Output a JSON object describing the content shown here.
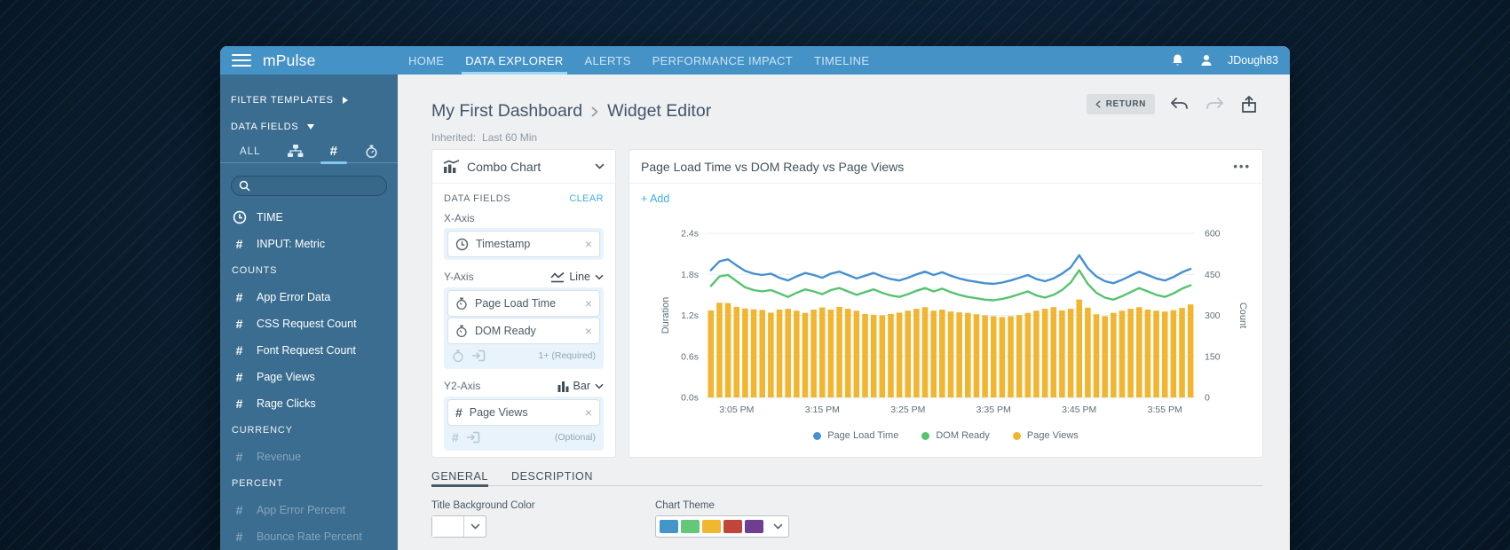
{
  "app": {
    "logo": "mPulse",
    "nav": [
      {
        "label": "HOME",
        "active": false
      },
      {
        "label": "DATA EXPLORER",
        "active": true
      },
      {
        "label": "ALERTS",
        "active": false
      },
      {
        "label": "PERFORMANCE IMPACT",
        "active": false
      },
      {
        "label": "TIMELINE",
        "active": false
      }
    ],
    "username": "JDough83",
    "accent_color": "#4592c7"
  },
  "sidebar": {
    "filter_templates_label": "FILTER TEMPLATES",
    "data_fields_label": "DATA FIELDS",
    "tabs": {
      "all_label": "ALL",
      "icons": [
        "hierarchy-icon",
        "hash-icon",
        "timer-icon"
      ],
      "active": "hash"
    },
    "search_value": "",
    "items": [
      {
        "type": "item",
        "icon": "clock",
        "label": "TIME"
      },
      {
        "type": "item",
        "icon": "hash",
        "label": "INPUT: Metric"
      },
      {
        "type": "section",
        "label": "COUNTS"
      },
      {
        "type": "item",
        "icon": "hash",
        "label": "App Error Data"
      },
      {
        "type": "item",
        "icon": "hash",
        "label": "CSS Request Count"
      },
      {
        "type": "item",
        "icon": "hash",
        "label": "Font Request Count"
      },
      {
        "type": "item",
        "icon": "hash",
        "label": "Page Views"
      },
      {
        "type": "item",
        "icon": "hash",
        "label": "Rage Clicks"
      },
      {
        "type": "section",
        "label": "CURRENCY"
      },
      {
        "type": "item",
        "icon": "hash",
        "label": "Revenue",
        "disabled": true
      },
      {
        "type": "section",
        "label": "PERCENT"
      },
      {
        "type": "item",
        "icon": "hash",
        "label": "App Error Percent",
        "disabled": true
      },
      {
        "type": "item",
        "icon": "hash",
        "label": "Bounce Rate Percent",
        "disabled": true
      }
    ]
  },
  "header": {
    "breadcrumb": {
      "parent": "My First Dashboard",
      "current": "Widget Editor"
    },
    "inherited_label": "Inherited:",
    "time_range": "Last 60 Min",
    "return_label": "RETURN"
  },
  "widget_panel": {
    "chart_type": "Combo Chart",
    "data_fields_label": "DATA FIELDS",
    "clear_label": "CLEAR",
    "x_axis": {
      "label": "X-Axis",
      "fields": [
        {
          "name": "Timestamp",
          "icon": "clock"
        }
      ]
    },
    "y_axis": {
      "label": "Y-Axis",
      "mode": "Line",
      "fields": [
        {
          "name": "Page Load Time",
          "icon": "timer"
        },
        {
          "name": "DOM Ready",
          "icon": "timer"
        }
      ],
      "hint": "1+ (Required)"
    },
    "y2_axis": {
      "label": "Y2-Axis",
      "mode": "Bar",
      "fields": [
        {
          "name": "Page Views",
          "icon": "hash"
        }
      ],
      "hint": "(Optional)"
    }
  },
  "chart_card": {
    "title": "Page Load Time vs DOM Ready vs Page Views",
    "add_label": "+ Add",
    "menu_label": "•••"
  },
  "chart_data": {
    "type": "combo",
    "x_tick_labels": [
      "3:05 PM",
      "3:15 PM",
      "3:25 PM",
      "3:35 PM",
      "3:45 PM",
      "3:55 PM"
    ],
    "x_tick_indices": [
      3,
      13,
      23,
      33,
      43,
      53
    ],
    "left_axis": {
      "title": "Duration",
      "ticks": [
        "2.4s",
        "1.8s",
        "1.2s",
        "0.6s",
        "0.0s"
      ],
      "min": 0,
      "max": 2.4
    },
    "right_axis": {
      "title": "Count",
      "ticks": [
        "600",
        "450",
        "300",
        "150",
        "0"
      ],
      "min": 0,
      "max": 600
    },
    "grid": true,
    "legend_position": "bottom",
    "series": [
      {
        "name": "Page Load Time",
        "type": "line",
        "axis": "left",
        "color": "#4690cf",
        "values": [
          1.86,
          1.99,
          2.02,
          1.93,
          1.85,
          1.81,
          1.79,
          1.81,
          1.75,
          1.71,
          1.77,
          1.82,
          1.79,
          1.75,
          1.81,
          1.84,
          1.79,
          1.74,
          1.78,
          1.82,
          1.77,
          1.73,
          1.71,
          1.75,
          1.8,
          1.84,
          1.79,
          1.83,
          1.78,
          1.74,
          1.71,
          1.69,
          1.67,
          1.66,
          1.68,
          1.71,
          1.75,
          1.79,
          1.73,
          1.7,
          1.74,
          1.81,
          1.9,
          2.08,
          1.89,
          1.77,
          1.7,
          1.67,
          1.72,
          1.78,
          1.84,
          1.79,
          1.74,
          1.71,
          1.76,
          1.83,
          1.88
        ]
      },
      {
        "name": "DOM Ready",
        "type": "line",
        "axis": "left",
        "color": "#57c36f",
        "values": [
          1.63,
          1.77,
          1.79,
          1.7,
          1.61,
          1.57,
          1.55,
          1.57,
          1.52,
          1.47,
          1.53,
          1.58,
          1.55,
          1.51,
          1.57,
          1.6,
          1.55,
          1.5,
          1.54,
          1.58,
          1.53,
          1.49,
          1.47,
          1.51,
          1.56,
          1.6,
          1.55,
          1.59,
          1.54,
          1.5,
          1.47,
          1.45,
          1.43,
          1.42,
          1.44,
          1.47,
          1.51,
          1.55,
          1.49,
          1.46,
          1.5,
          1.57,
          1.68,
          1.86,
          1.66,
          1.53,
          1.46,
          1.43,
          1.48,
          1.54,
          1.6,
          1.55,
          1.5,
          1.47,
          1.52,
          1.59,
          1.64
        ]
      },
      {
        "name": "Page Views",
        "type": "bar",
        "axis": "right",
        "color": "#f1b52f",
        "values": [
          318,
          346,
          345,
          331,
          325,
          322,
          320,
          310,
          321,
          324,
          317,
          309,
          321,
          329,
          321,
          331,
          324,
          317,
          305,
          302,
          300,
          305,
          310,
          317,
          324,
          330,
          317,
          321,
          314,
          311,
          309,
          304,
          300,
          297,
          294,
          297,
          301,
          309,
          317,
          324,
          330,
          318,
          324,
          358,
          328,
          304,
          297,
          309,
          317,
          324,
          330,
          321,
          317,
          314,
          319,
          327,
          340
        ]
      }
    ]
  },
  "settings": {
    "tabs": [
      {
        "label": "GENERAL",
        "active": true
      },
      {
        "label": "DESCRIPTION",
        "active": false
      }
    ],
    "title_bg_label": "Title Background Color",
    "title_bg_value": "#ffffff",
    "chart_theme_label": "Chart Theme",
    "theme_colors": [
      "#4596c8",
      "#63c878",
      "#f0b731",
      "#c0463c",
      "#6d3e92"
    ]
  }
}
